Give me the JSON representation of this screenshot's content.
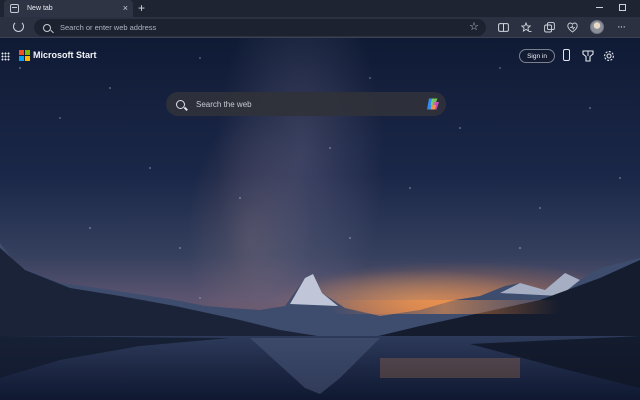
{
  "browser": {
    "tab": {
      "title": "New tab",
      "close_glyph": "×"
    },
    "new_tab_glyph": "+",
    "address_bar": {
      "placeholder": "Search or enter web address"
    }
  },
  "page": {
    "brand": "Microsoft Start",
    "sign_in": "Sign in",
    "search": {
      "placeholder": "Search the web"
    }
  },
  "colors": {
    "ms_logo": [
      "#f25022",
      "#7fba00",
      "#00a4ef",
      "#ffb900"
    ],
    "window_bg": "#1f2433",
    "search_bg": "#30323a"
  },
  "icons": [
    "tab-page-icon",
    "refresh-icon",
    "search-icon",
    "favorites-star-icon",
    "split-screen-icon",
    "favorites-icon",
    "collections-icon",
    "browser-essentials-icon",
    "profile-avatar",
    "more-icon",
    "apps-grid-icon",
    "phone-icon",
    "rewards-icon",
    "settings-icon",
    "copilot-icon"
  ]
}
